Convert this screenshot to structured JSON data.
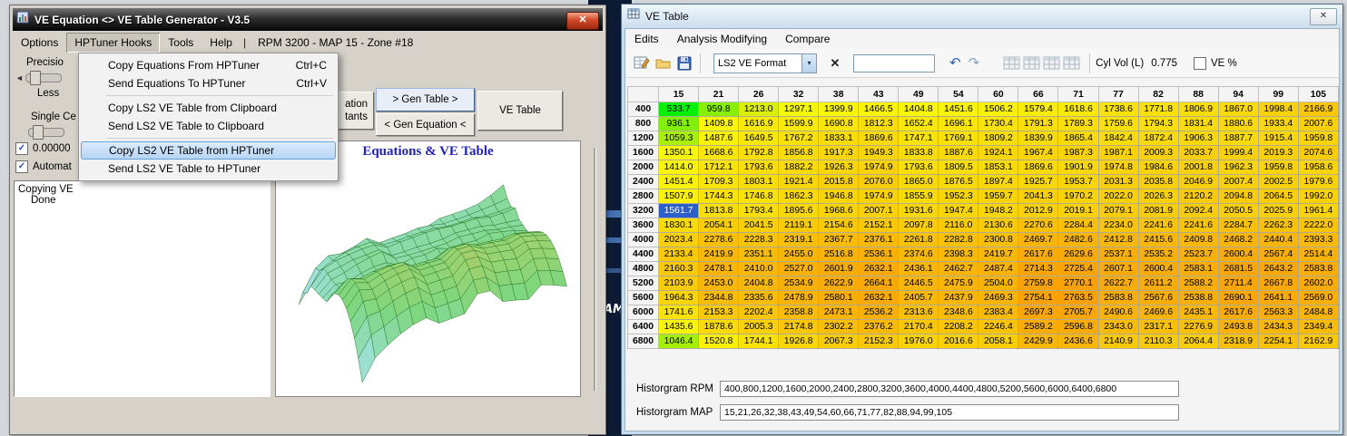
{
  "desktop": {
    "wallpaper_text": "AM"
  },
  "icons": {
    "close": "✕",
    "combo_arrow": "▾",
    "left_arrow": "◄",
    "check": "✓",
    "undo": "↶",
    "redo": "↷",
    "clear": "✕"
  },
  "generator_window": {
    "title": "VE Equation <> VE Table Generator  - V3.5",
    "menu_items": [
      "Options",
      "HPTuner Hooks",
      "Tools",
      "Help",
      "|"
    ],
    "menu_status": "RPM 3200  -  MAP 15  -  Zone #18",
    "hooks_menu": [
      {
        "label": "Copy Equations From HPTuner",
        "shortcut": "Ctrl+C"
      },
      {
        "label": "Send Equations To HPTuner",
        "shortcut": "Ctrl+V"
      },
      {
        "separator": true
      },
      {
        "label": "Copy LS2 VE Table from Clipboard",
        "shortcut": ""
      },
      {
        "label": "Send LS2 VE Table to Clipboard",
        "shortcut": ""
      },
      {
        "separator": true
      },
      {
        "label": "Copy LS2 VE Table from HPTuner",
        "shortcut": "",
        "highlighted": true
      },
      {
        "label": "Send LS2 VE Table to HPTuner",
        "shortcut": ""
      }
    ],
    "left_panel": {
      "precision_label": "Precisio",
      "less_label": "Less",
      "single_cell_label": "Single Ce",
      "check1_label": "0.00000",
      "check2_label": "Automat",
      "log_lines": [
        "Copying VE",
        "Done"
      ]
    },
    "buttons": {
      "eq_frag_top": "ation",
      "eq_frag_bottom": "tants",
      "gen_table": "> Gen Table >",
      "ve_table": "VE Table",
      "gen_equation": "< Gen Equation <"
    },
    "plot_title": "Equations & VE Table"
  },
  "table_window": {
    "title": "VE Table",
    "menu_items": [
      "Edits",
      "Analysis Modifying",
      "Compare"
    ],
    "toolbar": {
      "format_value": "LS2 VE Format",
      "cyl_vol_label": "Cyl Vol (L)",
      "cyl_vol_value": "0.775",
      "ve_percent_label": "VE %"
    },
    "histograms": {
      "rpm_label": "Historgram RPM",
      "rpm_value": "400,800,1200,1600,2000,2400,2800,3200,3600,4000,4400,4800,5200,5600,6000,6400,6800",
      "map_label": "Historgram MAP",
      "map_value": "15,21,26,32,38,43,49,54,60,66,71,77,82,88,94,99,105"
    }
  },
  "chart_data": {
    "type": "heatmap",
    "xlabel": "MAP",
    "ylabel": "RPM",
    "columns": [
      15,
      21,
      26,
      32,
      38,
      43,
      49,
      54,
      60,
      66,
      71,
      77,
      82,
      88,
      94,
      99,
      105
    ],
    "rows": [
      400,
      800,
      1200,
      1600,
      2000,
      2400,
      2800,
      3200,
      3600,
      4000,
      4400,
      4800,
      5200,
      5600,
      6000,
      6400,
      6800
    ],
    "values": [
      [
        533.7,
        959.8,
        1213.0,
        1297.1,
        1399.9,
        1466.5,
        1404.8,
        1451.6,
        1506.2,
        1579.4,
        1618.6,
        1738.6,
        1771.8,
        1806.9,
        1867.0,
        1998.4,
        2166.9
      ],
      [
        936.1,
        1409.8,
        1616.9,
        1599.9,
        1690.8,
        1812.3,
        1652.4,
        1696.1,
        1730.4,
        1791.3,
        1789.3,
        1759.6,
        1794.3,
        1831.4,
        1880.6,
        1933.4,
        2007.6
      ],
      [
        1059.3,
        1487.6,
        1649.5,
        1767.2,
        1833.1,
        1869.6,
        1747.1,
        1769.1,
        1809.2,
        1839.9,
        1865.4,
        1842.4,
        1872.4,
        1906.3,
        1887.7,
        1915.4,
        1959.8
      ],
      [
        1350.1,
        1668.6,
        1792.8,
        1856.8,
        1917.3,
        1949.3,
        1833.8,
        1887.6,
        1924.1,
        1967.4,
        1987.3,
        1987.1,
        2009.3,
        2033.7,
        1999.4,
        2019.3,
        2074.6
      ],
      [
        1414.0,
        1712.1,
        1793.6,
        1882.2,
        1926.3,
        1974.9,
        1793.6,
        1809.5,
        1853.1,
        1869.6,
        1901.9,
        1974.8,
        1984.6,
        2001.8,
        1962.3,
        1959.8,
        1958.6
      ],
      [
        1451.4,
        1709.3,
        1803.1,
        1921.4,
        2015.8,
        2076.0,
        1865.0,
        1876.5,
        1897.4,
        1925.7,
        1953.7,
        2031.3,
        2035.8,
        2046.9,
        2007.4,
        2002.5,
        1979.6
      ],
      [
        1507.9,
        1744.3,
        1746.8,
        1862.3,
        1946.8,
        1974.9,
        1855.9,
        1952.3,
        1959.7,
        2041.3,
        1970.2,
        2022.0,
        2026.3,
        2120.2,
        2094.8,
        2064.5,
        1992.0
      ],
      [
        1561.7,
        1813.8,
        1793.4,
        1895.6,
        1968.6,
        2007.1,
        1931.6,
        1947.4,
        1948.2,
        2012.9,
        2019.1,
        2079.1,
        2081.9,
        2092.4,
        2050.5,
        2025.9,
        1961.4
      ],
      [
        1830.1,
        2054.1,
        2041.5,
        2119.1,
        2154.6,
        2152.1,
        2097.8,
        2116.0,
        2130.6,
        2270.6,
        2284.4,
        2234.0,
        2241.6,
        2241.6,
        2284.7,
        2262.3,
        2222.0
      ],
      [
        2023.4,
        2278.6,
        2228.3,
        2319.1,
        2367.7,
        2376.1,
        2261.8,
        2282.8,
        2300.8,
        2469.7,
        2482.6,
        2412.8,
        2415.6,
        2409.8,
        2468.2,
        2440.4,
        2393.3
      ],
      [
        2133.4,
        2419.9,
        2351.1,
        2455.0,
        2516.8,
        2536.1,
        2374.6,
        2398.3,
        2419.7,
        2617.6,
        2629.6,
        2537.1,
        2535.2,
        2523.7,
        2600.4,
        2567.4,
        2514.4
      ],
      [
        2160.3,
        2478.1,
        2410.0,
        2527.0,
        2601.9,
        2632.1,
        2436.1,
        2462.7,
        2487.4,
        2714.3,
        2725.4,
        2607.1,
        2600.4,
        2583.1,
        2681.5,
        2643.2,
        2583.8
      ],
      [
        2103.9,
        2453.0,
        2404.8,
        2534.9,
        2622.9,
        2664.1,
        2446.5,
        2475.9,
        2504.0,
        2759.8,
        2770.1,
        2622.7,
        2611.2,
        2588.2,
        2711.4,
        2667.8,
        2602.0
      ],
      [
        1964.3,
        2344.8,
        2335.6,
        2478.9,
        2580.1,
        2632.1,
        2405.7,
        2437.9,
        2469.3,
        2754.1,
        2763.5,
        2583.8,
        2567.6,
        2538.8,
        2690.1,
        2641.1,
        2569.0
      ],
      [
        1741.6,
        2153.3,
        2202.4,
        2358.8,
        2473.1,
        2536.2,
        2313.6,
        2348.6,
        2383.4,
        2697.3,
        2705.7,
        2490.6,
        2469.6,
        2435.1,
        2617.6,
        2563.3,
        2484.8
      ],
      [
        1435.6,
        1878.6,
        2005.3,
        2174.8,
        2302.2,
        2376.2,
        2170.4,
        2208.2,
        2246.4,
        2589.2,
        2596.8,
        2343.0,
        2317.1,
        2276.9,
        2493.8,
        2434.3,
        2349.4
      ],
      [
        1046.4,
        1520.8,
        1744.1,
        1926.8,
        2067.3,
        2152.3,
        1976.0,
        2016.6,
        2058.1,
        2429.9,
        2436.6,
        2140.9,
        2110.3,
        2064.4,
        2318.9,
        2254.1,
        2162.9
      ]
    ],
    "selected_cell": {
      "rpm": 3200,
      "map": 15,
      "value": 1561.7
    }
  }
}
